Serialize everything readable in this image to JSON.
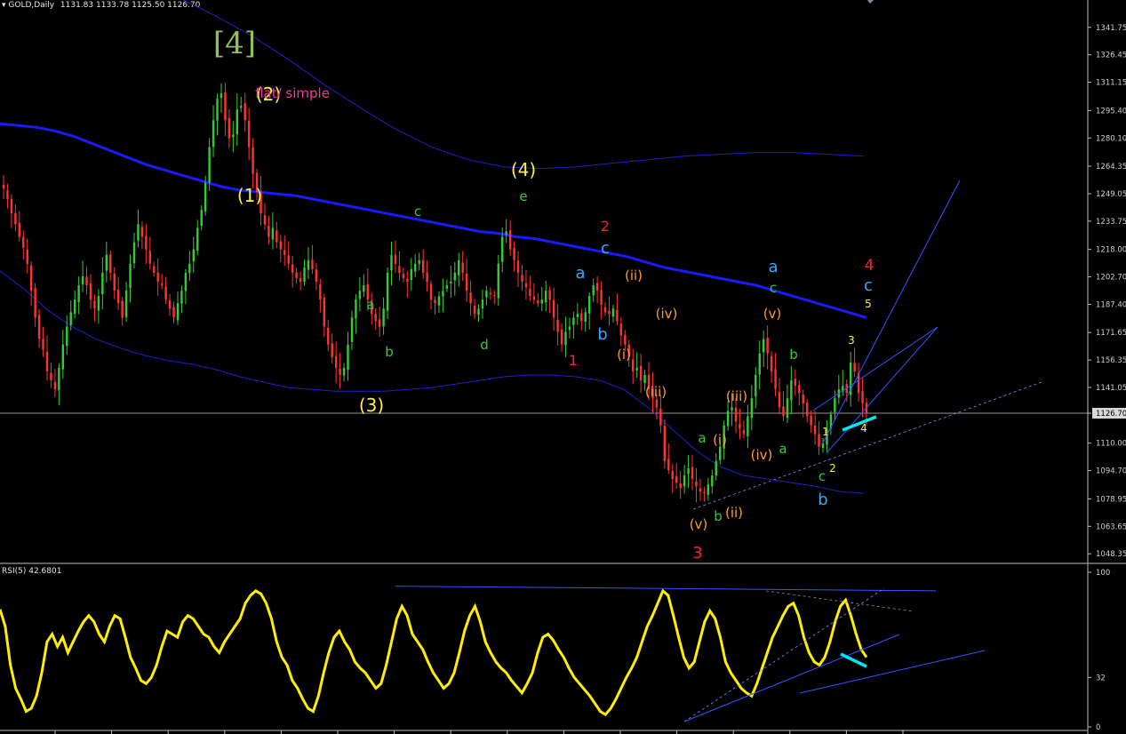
{
  "header": {
    "symbol": "GOLD,Daily",
    "ohlc": "1131.83 1133.78 1125.50 1126.70"
  },
  "rsi_header": "RSI(5) 42.6801",
  "colors": {
    "background": "#000000",
    "bull": "#33cc33",
    "bear": "#ff3333",
    "ma": "#1a1aff",
    "envelope": "#2020cc",
    "rsi": "#ffee00",
    "trendline": "#3355ff",
    "axis_text": "#d0d0d0",
    "highlight": "#00e5ee"
  },
  "chart_data": [
    {
      "type": "candlestick",
      "title": "GOLD,Daily",
      "yaxis": {
        "range": [
          1044,
          1356
        ],
        "ticks": [
          "1341.75",
          "1326.45",
          "1311.15",
          "1295.40",
          "1280.10",
          "1264.35",
          "1249.05",
          "1233.75",
          "1218.00",
          "1202.70",
          "1187.40",
          "1171.65",
          "1156.35",
          "1141.05",
          "1126.70",
          "1110.00",
          "1094.70",
          "1078.95",
          "1063.65",
          "1048.35"
        ],
        "current_price": "1126.70"
      },
      "close_series": [
        1252,
        1246,
        1238,
        1232,
        1225,
        1219,
        1210,
        1195,
        1180,
        1168,
        1162,
        1150,
        1145,
        1140,
        1152,
        1165,
        1175,
        1183,
        1190,
        1198,
        1203,
        1198,
        1190,
        1185,
        1192,
        1205,
        1215,
        1205,
        1195,
        1188,
        1180,
        1195,
        1210,
        1222,
        1232,
        1225,
        1218,
        1210,
        1205,
        1200,
        1198,
        1190,
        1185,
        1180,
        1188,
        1195,
        1205,
        1210,
        1218,
        1230,
        1240,
        1255,
        1275,
        1290,
        1302,
        1305,
        1290,
        1280,
        1282,
        1296,
        1298,
        1290,
        1275,
        1260,
        1250,
        1238,
        1232,
        1225,
        1230,
        1222,
        1218,
        1215,
        1210,
        1205,
        1202,
        1200,
        1208,
        1212,
        1207,
        1200,
        1190,
        1175,
        1165,
        1158,
        1152,
        1148,
        1152,
        1165,
        1180,
        1190,
        1195,
        1198,
        1190,
        1182,
        1178,
        1175,
        1185,
        1205,
        1215,
        1210,
        1205,
        1202,
        1200,
        1207,
        1210,
        1212,
        1205,
        1200,
        1190,
        1188,
        1192,
        1195,
        1198,
        1200,
        1205,
        1212,
        1205,
        1195,
        1188,
        1182,
        1185,
        1190,
        1195,
        1193,
        1192,
        1210,
        1225,
        1228,
        1218,
        1212,
        1205,
        1200,
        1197,
        1192,
        1190,
        1188,
        1190,
        1195,
        1190,
        1180,
        1172,
        1165,
        1172,
        1175,
        1180,
        1182,
        1178,
        1183,
        1192,
        1198,
        1195,
        1187,
        1183,
        1182,
        1185,
        1178,
        1170,
        1165,
        1158,
        1150,
        1152,
        1145,
        1148,
        1140,
        1135,
        1130,
        1120,
        1100,
        1095,
        1090,
        1088,
        1085,
        1092,
        1096,
        1090,
        1086,
        1083,
        1082,
        1087,
        1092,
        1100,
        1108,
        1120,
        1128,
        1130,
        1122,
        1118,
        1115,
        1125,
        1135,
        1148,
        1160,
        1168,
        1160,
        1150,
        1140,
        1130,
        1125,
        1135,
        1145,
        1142,
        1138,
        1132,
        1125,
        1120,
        1115,
        1108,
        1110,
        1118,
        1126,
        1135,
        1140,
        1142,
        1138,
        1155,
        1150,
        1138,
        1132,
        1126.7
      ],
      "ma_series": [
        1288,
        1287,
        1286,
        1284,
        1281,
        1277,
        1273,
        1269,
        1265,
        1262,
        1259,
        1256,
        1253,
        1251,
        1250,
        1249,
        1248,
        1246,
        1244,
        1242,
        1240,
        1238,
        1236,
        1234,
        1232,
        1230,
        1228,
        1227,
        1225,
        1224,
        1222,
        1220,
        1218,
        1216,
        1214,
        1211,
        1208,
        1206,
        1204,
        1202,
        1200,
        1198,
        1195,
        1192,
        1189,
        1186,
        1183,
        1180
      ],
      "upper_band_series": [
        1378,
        1377,
        1375,
        1372,
        1366,
        1358,
        1348,
        1337,
        1324,
        1310,
        1297,
        1285,
        1275,
        1268,
        1264,
        1263,
        1264,
        1266,
        1268,
        1270,
        1271,
        1272,
        1272,
        1271,
        1270
      ],
      "lower_band_series": [
        1206,
        1196,
        1184,
        1175,
        1168,
        1163,
        1159,
        1156,
        1154,
        1151,
        1147,
        1144,
        1141,
        1140,
        1139,
        1139,
        1139,
        1140,
        1141,
        1143,
        1145,
        1147,
        1148,
        1148,
        1147,
        1145,
        1140,
        1130,
        1118,
        1106,
        1097,
        1092,
        1090,
        1088,
        1086,
        1083,
        1082
      ],
      "wave_labels": [
        "[4]",
        "(2)",
        "flat/ simple",
        "(1)",
        "(3)",
        "(4)",
        "e",
        "c",
        "a",
        "b",
        "d",
        "2",
        "c",
        "a",
        "b",
        "1",
        "(ii)",
        "(i)",
        "(iv)",
        "(iii)",
        "3",
        "(v)",
        "b",
        "(ii)",
        "a",
        "(i)",
        "(iv)",
        "(iii)",
        "a",
        "c",
        "(v)",
        "b",
        "a",
        "c",
        "b",
        "4",
        "c",
        "5",
        "3",
        "1",
        "2",
        "4"
      ]
    },
    {
      "type": "line",
      "title": "RSI(5) 42.6801",
      "yaxis": {
        "range": [
          0,
          100
        ],
        "ticks": [
          "100",
          "32",
          "0"
        ]
      },
      "values": [
        76,
        65,
        40,
        25,
        18,
        10,
        12,
        20,
        35,
        55,
        60,
        52,
        58,
        48,
        55,
        62,
        68,
        72,
        68,
        60,
        55,
        65,
        72,
        70,
        58,
        45,
        38,
        30,
        28,
        32,
        40,
        52,
        62,
        60,
        58,
        68,
        72,
        70,
        65,
        60,
        58,
        52,
        48,
        55,
        60,
        65,
        70,
        80,
        85,
        88,
        86,
        80,
        70,
        55,
        45,
        40,
        30,
        25,
        18,
        12,
        10,
        20,
        35,
        48,
        58,
        62,
        55,
        50,
        42,
        38,
        35,
        30,
        25,
        28,
        40,
        55,
        70,
        78,
        72,
        60,
        55,
        50,
        42,
        35,
        30,
        25,
        28,
        35,
        48,
        62,
        72,
        78,
        68,
        55,
        48,
        42,
        38,
        35,
        30,
        26,
        22,
        28,
        35,
        48,
        58,
        60,
        56,
        50,
        45,
        38,
        32,
        28,
        24,
        20,
        15,
        10,
        8,
        12,
        18,
        25,
        32,
        38,
        45,
        55,
        65,
        72,
        80,
        88,
        85,
        72,
        58,
        45,
        38,
        42,
        55,
        68,
        75,
        70,
        58,
        42,
        35,
        30,
        25,
        22,
        20,
        28,
        38,
        48,
        58,
        65,
        72,
        78,
        80,
        72,
        58,
        48,
        42,
        40,
        45,
        55,
        68,
        78,
        82,
        72,
        60,
        50,
        45
      ]
    }
  ]
}
